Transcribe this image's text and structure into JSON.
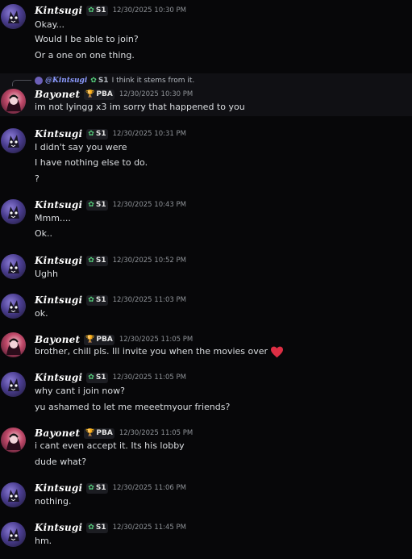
{
  "messages": [
    {
      "author": "Kintsugi",
      "tag": "S1",
      "tag_icon": "s1-badge-icon",
      "time": "12/30/2025 10:30 PM",
      "lines": [
        "Okay...",
        "Would I be able to join?",
        "Or a one on one thing."
      ]
    },
    {
      "author": "Bayonet",
      "tag": "PBA",
      "tag_icon": "trophy-icon",
      "time": "12/30/2025 10:30 PM",
      "reply": {
        "name": "@Kintsugi",
        "tag": "S1",
        "text": "I think it stems from it."
      },
      "lines": [
        "im not lyingg x3 im sorry that happened to you"
      ]
    },
    {
      "author": "Kintsugi",
      "tag": "S1",
      "tag_icon": "s1-badge-icon",
      "time": "12/30/2025 10:31 PM",
      "lines": [
        "I didn't say you were",
        "I have nothing else to do.",
        "?"
      ]
    },
    {
      "author": "Kintsugi",
      "tag": "S1",
      "tag_icon": "s1-badge-icon",
      "time": "12/30/2025 10:43 PM",
      "lines": [
        "Mmm....",
        "Ok.."
      ]
    },
    {
      "author": "Kintsugi",
      "tag": "S1",
      "tag_icon": "s1-badge-icon",
      "time": "12/30/2025 10:52 PM",
      "lines": [
        "Ughh"
      ]
    },
    {
      "author": "Kintsugi",
      "tag": "S1",
      "tag_icon": "s1-badge-icon",
      "time": "12/30/2025 11:03 PM",
      "lines": [
        "ok."
      ]
    },
    {
      "author": "Bayonet",
      "tag": "PBA",
      "tag_icon": "trophy-icon",
      "time": "12/30/2025 11:05 PM",
      "lines": [
        "brother, chill pls. Ill invite you when the movies over"
      ],
      "emoji": "heart-icon",
      "emoji_color": "#dd2e44"
    },
    {
      "author": "Kintsugi",
      "tag": "S1",
      "tag_icon": "s1-badge-icon",
      "time": "12/30/2025 11:05 PM",
      "lines": [
        "why cant i join now?",
        "yu ashamed to let me meeetmyour friends?"
      ]
    },
    {
      "author": "Bayonet",
      "tag": "PBA",
      "tag_icon": "trophy-icon",
      "time": "12/30/2025 11:05 PM",
      "lines": [
        "i cant even accept it. Its his lobby",
        "dude what?"
      ]
    },
    {
      "author": "Kintsugi",
      "tag": "S1",
      "tag_icon": "s1-badge-icon",
      "time": "12/30/2025 11:06 PM",
      "lines": [
        "nothing."
      ]
    },
    {
      "author": "Kintsugi",
      "tag": "S1",
      "tag_icon": "s1-badge-icon",
      "time": "12/30/2025 11:45 PM",
      "lines": [
        "hm."
      ]
    }
  ],
  "colors": {
    "background": "#070709",
    "highlight": "#101014",
    "text": "#dbdee1",
    "timestamp": "#8e9297",
    "reply_mention": "#8c9bff",
    "s1_badge": "#57d17e",
    "trophy": "#f0b232"
  }
}
